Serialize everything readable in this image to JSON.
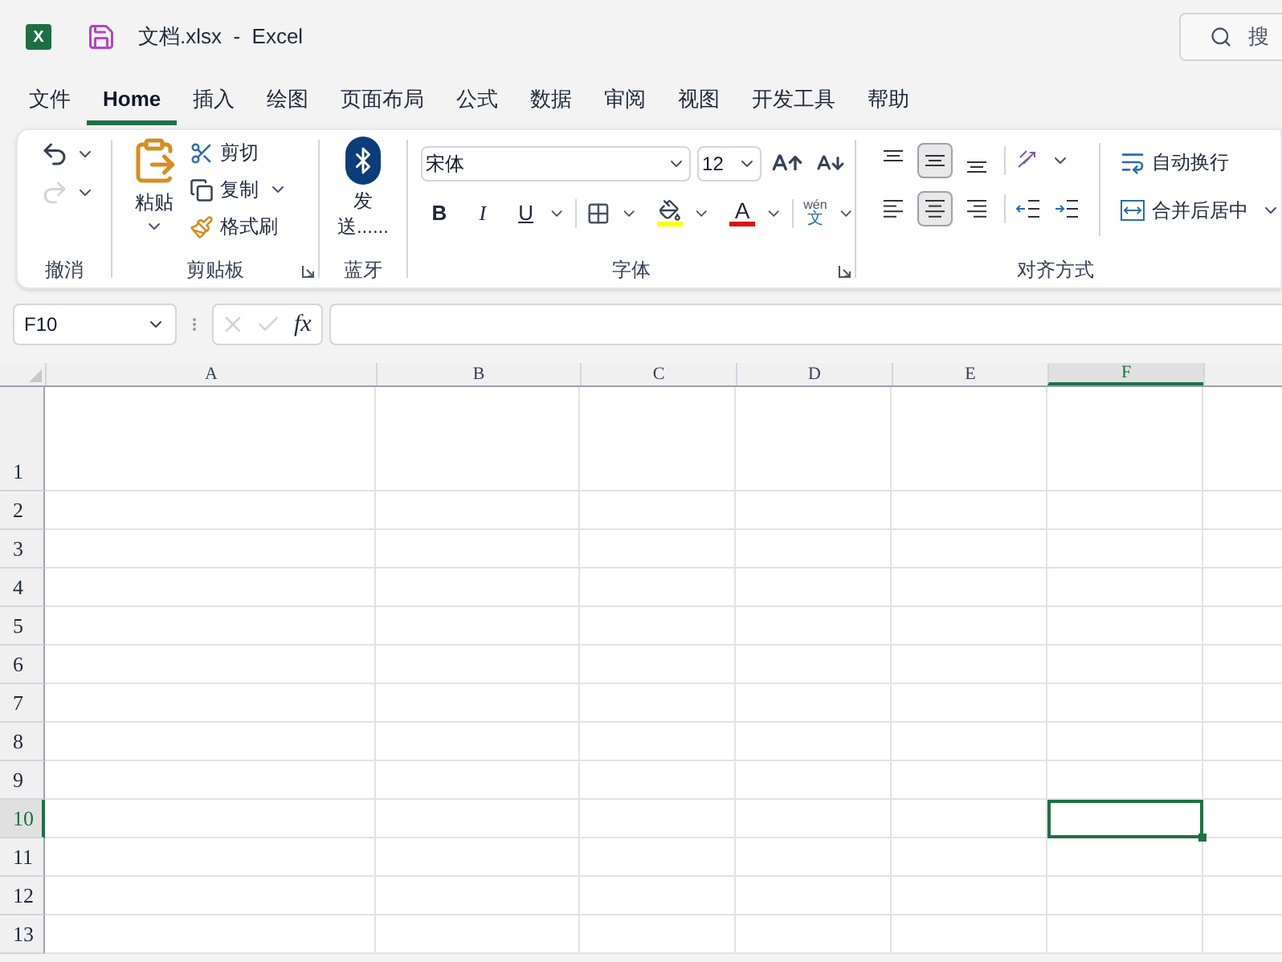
{
  "window": {
    "app_badge": "X",
    "title": "文档.xlsx  -  Excel"
  },
  "search": {
    "placeholder": "搜"
  },
  "tabs": [
    {
      "label": "文件",
      "selected": false
    },
    {
      "label": "Home",
      "selected": true
    },
    {
      "label": "插入",
      "selected": false
    },
    {
      "label": "绘图",
      "selected": false
    },
    {
      "label": "页面布局",
      "selected": false
    },
    {
      "label": "公式",
      "selected": false
    },
    {
      "label": "数据",
      "selected": false
    },
    {
      "label": "审阅",
      "selected": false
    },
    {
      "label": "视图",
      "selected": false
    },
    {
      "label": "开发工具",
      "selected": false
    },
    {
      "label": "帮助",
      "selected": false
    }
  ],
  "ribbon": {
    "undo": {
      "label": "撤消",
      "undo_disabled": false,
      "redo_disabled": true
    },
    "clipboard": {
      "label": "剪贴板",
      "paste": "粘贴",
      "cut": "剪切",
      "copy": "复制",
      "format_painter": "格式刷"
    },
    "bluetooth": {
      "label": "蓝牙",
      "send": "发送......"
    },
    "font": {
      "label": "字体",
      "name": "宋体",
      "size": "12",
      "bold": "B",
      "italic": "I",
      "underline": "U",
      "font_color_letter": "A",
      "phonetic_top": "wén",
      "phonetic_bottom": "文"
    },
    "alignment": {
      "label": "对齐方式",
      "vertical": [
        {
          "kind": "top",
          "selected": false
        },
        {
          "kind": "middle",
          "selected": true
        },
        {
          "kind": "bottom",
          "selected": false
        }
      ],
      "horizontal": [
        {
          "kind": "left",
          "selected": false
        },
        {
          "kind": "center",
          "selected": true
        },
        {
          "kind": "right",
          "selected": false
        }
      ],
      "wrap_text": "自动换行",
      "merge_center": "合并后居中"
    }
  },
  "formula_bar": {
    "name_box": "F10",
    "fx": "fx"
  },
  "columns": [
    {
      "label": "A",
      "selected": false
    },
    {
      "label": "B",
      "selected": false
    },
    {
      "label": "C",
      "selected": false
    },
    {
      "label": "D",
      "selected": false
    },
    {
      "label": "E",
      "selected": false
    },
    {
      "label": "F",
      "selected": true
    }
  ],
  "rows": [
    {
      "label": "1",
      "selected": false
    },
    {
      "label": "2",
      "selected": false
    },
    {
      "label": "3",
      "selected": false
    },
    {
      "label": "4",
      "selected": false
    },
    {
      "label": "5",
      "selected": false
    },
    {
      "label": "6",
      "selected": false
    },
    {
      "label": "7",
      "selected": false
    },
    {
      "label": "8",
      "selected": false
    },
    {
      "label": "9",
      "selected": false
    },
    {
      "label": "10",
      "selected": true
    },
    {
      "label": "11",
      "selected": false
    },
    {
      "label": "12",
      "selected": false
    },
    {
      "label": "13",
      "selected": false
    }
  ]
}
